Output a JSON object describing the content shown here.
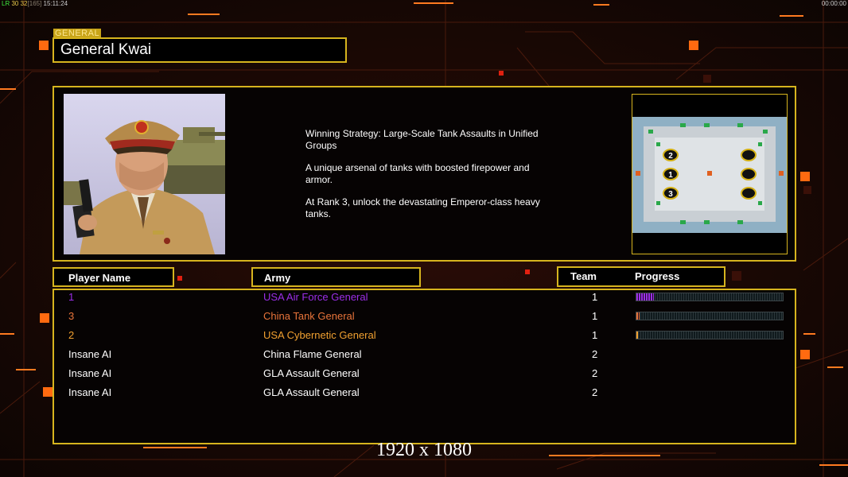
{
  "hud": {
    "status_prefix": "LR",
    "fps_current": "30",
    "fps_avg": "32",
    "frame_count": "[165]",
    "clock": "15:11:24",
    "timer": "00:00:00"
  },
  "general_label": "GENERAL",
  "general_name": "General Kwai",
  "description": [
    "Winning Strategy: Large-Scale Tank Assaults in Unified\n Groups",
    "A unique arsenal of tanks with boosted firepower and\n armor.",
    "At Rank 3, unlock the devastating Emperor-class heavy\n tanks."
  ],
  "map": {
    "start_positions": [
      "2",
      "1",
      "3"
    ]
  },
  "columns": {
    "player": "Player Name",
    "army": "Army",
    "team": "Team",
    "progress": "Progress"
  },
  "players": [
    {
      "name": "1",
      "army": "USA Air Force General",
      "team": "1",
      "color": "#9b2ee6",
      "progress": 0.12
    },
    {
      "name": "3",
      "army": "China Tank General",
      "team": "1",
      "color": "#e8743a",
      "progress": 0.02
    },
    {
      "name": "2",
      "army": "USA Cybernetic General",
      "team": "1",
      "color": "#f0a030",
      "progress": 0.01
    },
    {
      "name": "Insane AI",
      "army": "China Flame General",
      "team": "2",
      "color": "#ffffff"
    },
    {
      "name": "Insane AI",
      "army": "GLA Assault General",
      "team": "2",
      "color": "#ffffff"
    },
    {
      "name": "Insane AI",
      "army": "GLA Assault General",
      "team": "2",
      "color": "#ffffff"
    }
  ],
  "resolution_text": "1920 x 1080",
  "colors": {
    "frame_gold": "#d6b41e",
    "accent_orange": "#ff6a00",
    "circuit_red": "#6a1a08"
  }
}
